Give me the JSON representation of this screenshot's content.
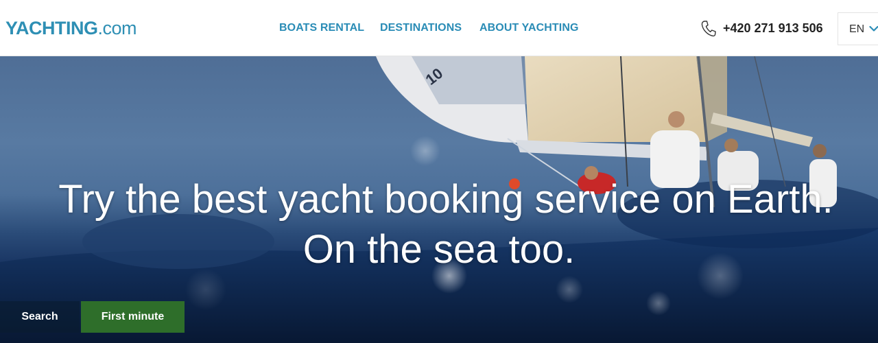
{
  "header": {
    "logo": {
      "brand": "YACHTING",
      "tld": ".com"
    },
    "nav": [
      {
        "label": "BOATS RENTAL"
      },
      {
        "label": "DESTINATIONS"
      },
      {
        "label": "ABOUT YACHTING"
      }
    ],
    "phone": "+420 271 913 506",
    "language": "EN"
  },
  "hero": {
    "headline_line1": "Try the best yacht booking service on Earth.",
    "headline_line2": "On the sea too.",
    "sail_number": "10"
  },
  "tabs": [
    {
      "label": "Search"
    },
    {
      "label": "First minute"
    }
  ],
  "colors": {
    "brand": "#2e8fb4",
    "nav": "#2a8cb6",
    "first_minute": "#2e6e2a"
  }
}
